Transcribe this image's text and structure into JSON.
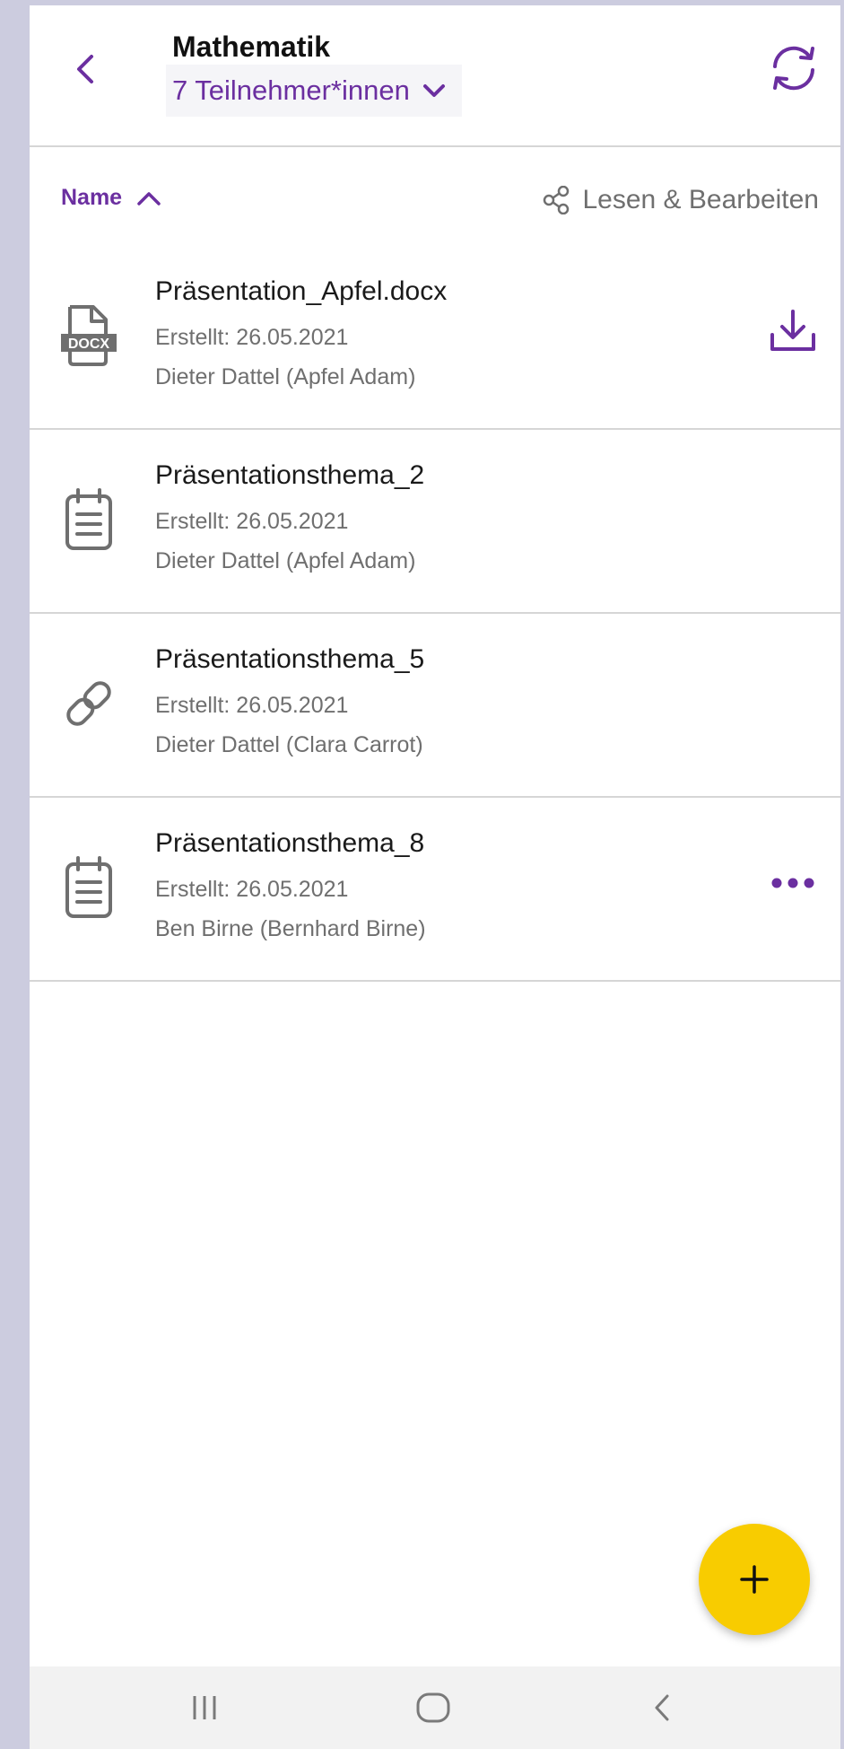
{
  "header": {
    "title": "Mathematik",
    "participants_label": "7 Teilnehmer*innen"
  },
  "sort": {
    "label": "Name",
    "direction": "ascending",
    "share_mode": "Lesen & Bearbeiten"
  },
  "items": [
    {
      "name": "Präsentation_Apfel.docx",
      "date": "Erstellt: 26.05.2021",
      "owner": "Dieter Dattel (Apfel Adam)",
      "icon": "docx-file-icon",
      "action": "download-icon"
    },
    {
      "name": "Präsentationsthema_2",
      "date": "Erstellt: 26.05.2021",
      "owner": "Dieter Dattel (Apfel Adam)",
      "icon": "clipboard-icon",
      "action": ""
    },
    {
      "name": "Präsentationsthema_5",
      "date": "Erstellt: 26.05.2021",
      "owner": "Dieter Dattel (Clara  Carrot)",
      "icon": "link-icon",
      "action": ""
    },
    {
      "name": "Präsentationsthema_8",
      "date": "Erstellt: 26.05.2021",
      "owner": "Ben Birne (Bernhard Birne)",
      "icon": "clipboard-icon",
      "action": "more-icon"
    }
  ],
  "colors": {
    "accent": "#6b2fa0",
    "fab": "#f8cc00",
    "frame": "#ccccdf",
    "icon_gray": "#6f6f6f"
  }
}
